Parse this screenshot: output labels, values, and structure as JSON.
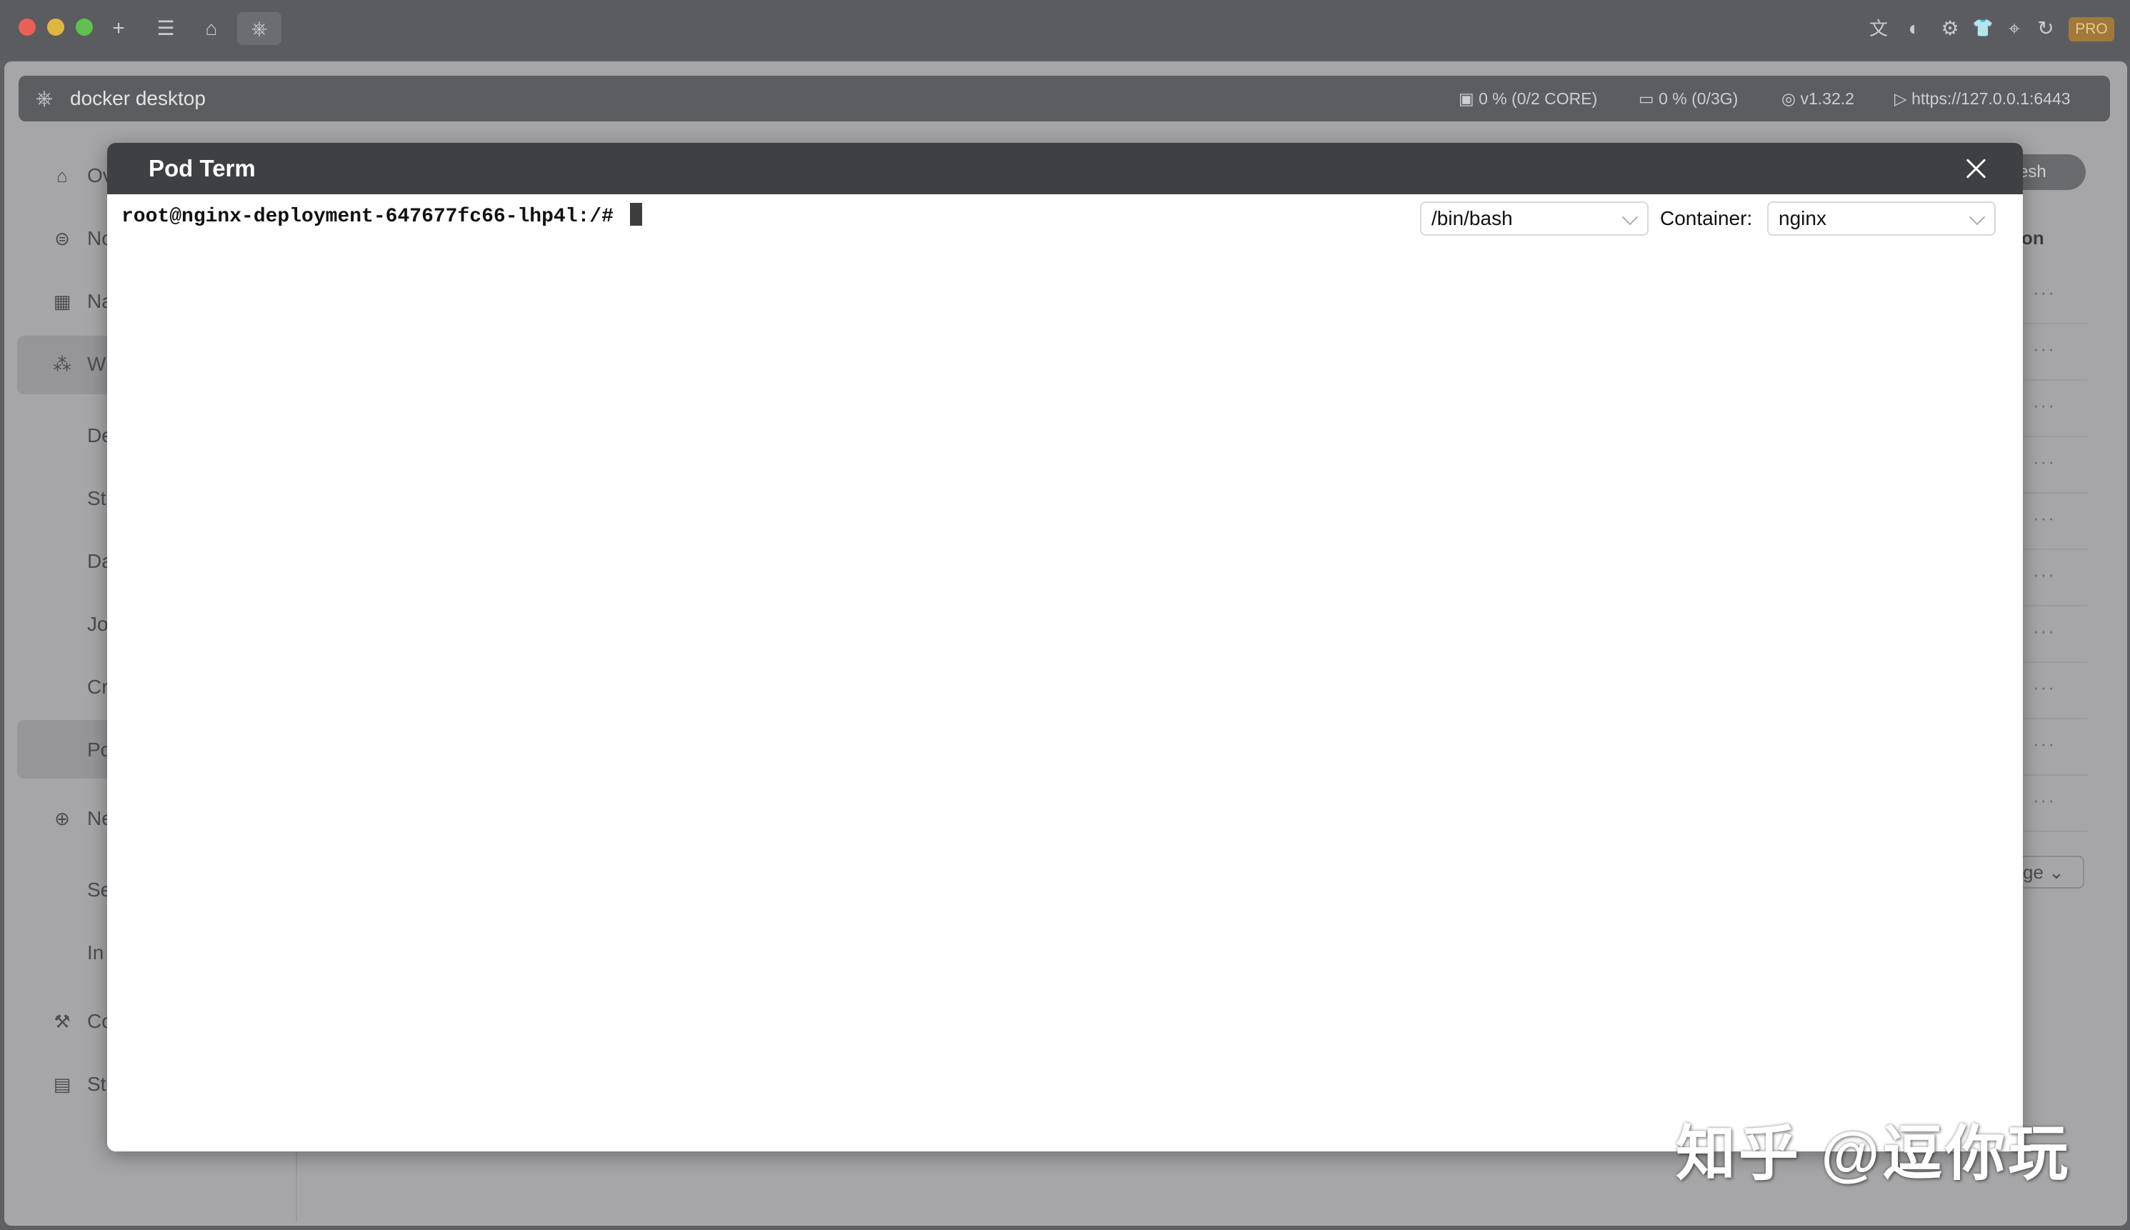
{
  "window": {
    "pro_badge": "PRO",
    "toolbar_icons": [
      "plus-icon",
      "list-icon",
      "home-icon",
      "kubernetes-icon"
    ],
    "right_icons": [
      "translate-icon",
      "shield-icon",
      "gear-icon",
      "shirt-icon",
      "target-icon",
      "refresh-icon"
    ],
    "colors": {
      "close": "#ec5f57",
      "minimize": "#e0b73d",
      "zoom": "#5fc14d"
    }
  },
  "appbar": {
    "title": "docker desktop",
    "cpu": "0 % (0/2 CORE)",
    "memory": "0 % (0/3G)",
    "version": "v1.32.2",
    "endpoint": "https://127.0.0.1:6443"
  },
  "sidebar": {
    "items": [
      {
        "label": "Ov",
        "icon": "home-icon"
      },
      {
        "label": "No",
        "icon": "node-icon"
      },
      {
        "label": "Na",
        "icon": "table-icon"
      },
      {
        "label": "W",
        "icon": "workload-icon"
      },
      {
        "label": "De"
      },
      {
        "label": "St"
      },
      {
        "label": "Da"
      },
      {
        "label": "Jo"
      },
      {
        "label": "Cr"
      },
      {
        "label": "Po"
      },
      {
        "label": "Ne",
        "icon": "globe-icon"
      },
      {
        "label": "Se"
      },
      {
        "label": "In"
      },
      {
        "label": "Co",
        "icon": "wrench-icon"
      },
      {
        "label": "St",
        "icon": "storage-icon"
      }
    ]
  },
  "background_right": {
    "refresh_label": "resh",
    "column_header": "on",
    "row_action": "···",
    "page_size": "ge"
  },
  "modal": {
    "title": "Pod Term",
    "prompt": "root@nginx-deployment-647677fc66-lhp4l:/#",
    "shell": "/bin/bash",
    "container_label": "Container:",
    "container": "nginx"
  },
  "watermark": "知乎 @逗你玩"
}
